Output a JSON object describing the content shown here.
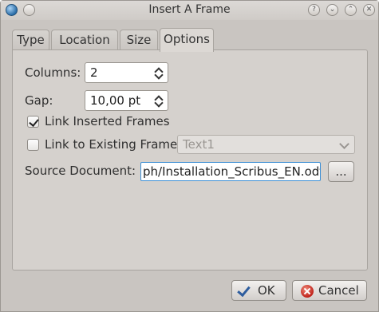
{
  "window": {
    "title": "Insert A Frame"
  },
  "titlebar_buttons": [
    "?",
    "⌄",
    "⌃",
    "✕"
  ],
  "tabs": [
    {
      "label": "Type"
    },
    {
      "label": "Location"
    },
    {
      "label": "Size"
    },
    {
      "label": "Options"
    }
  ],
  "active_tab": "Options",
  "options": {
    "columns_label": "Columns:",
    "columns_value": "2",
    "gap_label": "Gap:",
    "gap_value": "10,00 pt",
    "link_inserted_label": "Link Inserted Frames",
    "link_inserted_checked": true,
    "link_existing_label": "Link to Existing Frame",
    "link_existing_checked": false,
    "existing_frame_value": "Text1",
    "source_document_label": "Source Document:",
    "source_document_value": "ph/Installation_Scribus_EN.odt",
    "browse_label": "..."
  },
  "buttons": {
    "ok_label": "OK",
    "cancel_label": "Cancel"
  },
  "colors": {
    "window_bg": "#c9c5c1",
    "focus_border": "#3d8fd4",
    "ok_icon": "#2e5d9e",
    "cancel_icon": "#c0221a"
  }
}
